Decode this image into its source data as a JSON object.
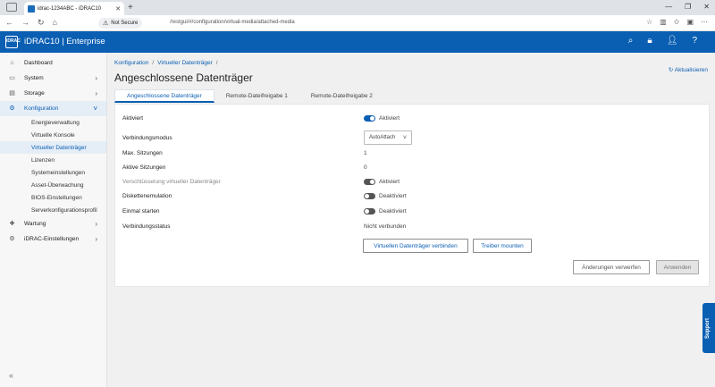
{
  "browser": {
    "tab_title": "idrac-1234ABC - iDRAC10",
    "new_tab": "+",
    "not_secure": "Not Secure",
    "url": "/restgui/#/configuration/virtual-media/attached-media"
  },
  "header": {
    "logo_text": "iDRAC",
    "title": "iDRAC10 | Enterprise"
  },
  "sidebar": {
    "items": [
      {
        "label": "Dashboard",
        "icon": "dashboard-icon"
      },
      {
        "label": "System",
        "icon": "system-icon"
      },
      {
        "label": "Storage",
        "icon": "storage-icon"
      },
      {
        "label": "Konfiguration",
        "icon": "configuration-icon"
      }
    ],
    "subitems": [
      {
        "label": "Energieverwaltung"
      },
      {
        "label": "Virtuelle Konsole"
      },
      {
        "label": "Virtueller Datenträger"
      },
      {
        "label": "Lizenzen"
      },
      {
        "label": "Systemeinstellungen"
      },
      {
        "label": "Asset-Überwachung"
      },
      {
        "label": "BIOS-Einstellungen"
      },
      {
        "label": "Serverkonfigurationsprofil"
      }
    ],
    "bottom_items": [
      {
        "label": "Wartung",
        "icon": "maintenance-icon"
      },
      {
        "label": "iDRAC-Einstellungen",
        "icon": "idrac-settings-icon"
      }
    ]
  },
  "breadcrumb": {
    "items": [
      "Konfiguration",
      "Virtueller Datenträger"
    ],
    "separator": "/"
  },
  "page": {
    "title": "Angeschlossene Datenträger",
    "refresh": "Aktualisieren"
  },
  "tabs": [
    {
      "label": "Angeschlossene Datenträger"
    },
    {
      "label": "Remote-Dateifreigabe 1"
    },
    {
      "label": "Remote-Dateifreigabe 2"
    }
  ],
  "form": {
    "aktiviert": {
      "label": "Aktiviert",
      "value": "Aktiviert",
      "state": "on"
    },
    "verbindungsmodus": {
      "label": "Verbindungsmodus",
      "value": "AutoAttach"
    },
    "max_sitzungen": {
      "label": "Max. Sitzungen",
      "value": "1"
    },
    "aktive_sitzungen": {
      "label": "Aktive Sitzungen",
      "value": "0"
    },
    "verschluesselung": {
      "label": "Verschlüsselung virtueller Datenträger",
      "value": "Aktiviert",
      "state": "on-disabled"
    },
    "diskettenemulation": {
      "label": "Diskettenemulation",
      "value": "Deaktiviert",
      "state": "off"
    },
    "einmal_starten": {
      "label": "Einmal starten",
      "value": "Deaktiviert",
      "state": "off"
    },
    "verbindungsstatus": {
      "label": "Verbindungsstatus",
      "value": "Nicht verbunden"
    }
  },
  "buttons": {
    "connect": "Virtuellen Datenträger verbinden",
    "mount_driver": "Treiber mounten",
    "discard": "Änderungen verwerfen",
    "apply": "Anwenden"
  },
  "support": {
    "label": "Support"
  },
  "colors": {
    "accent": "#0b5fb3"
  }
}
